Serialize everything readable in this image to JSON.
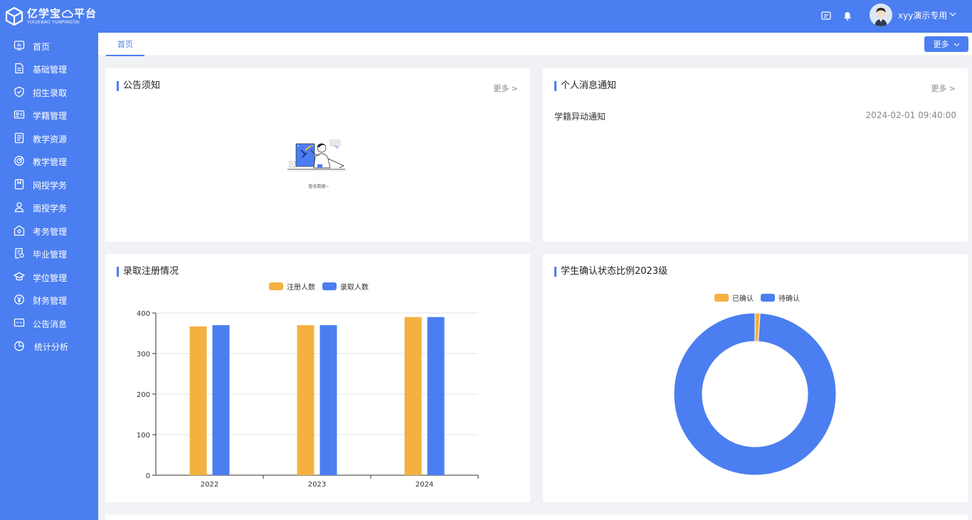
{
  "header": {
    "logo_main": "亿学宝",
    "logo_main2": "平台",
    "logo_sub": "YIXUEBAO YUNPINGTAI",
    "user_name": "xyy演示专用",
    "icons": [
      "screen-icon",
      "bell-icon",
      "chevron-down-icon"
    ]
  },
  "sidebar": {
    "items": [
      {
        "label": "首页",
        "icon": "dashboard-icon"
      },
      {
        "label": "基础管理",
        "icon": "document-icon"
      },
      {
        "label": "招生录取",
        "icon": "shield-check-icon"
      },
      {
        "label": "学籍管理",
        "icon": "id-card-icon"
      },
      {
        "label": "教学资源",
        "icon": "file-list-icon"
      },
      {
        "label": "教学管理",
        "icon": "target-icon"
      },
      {
        "label": "网授学务",
        "icon": "bookmark-icon"
      },
      {
        "label": "面授学务",
        "icon": "user-icon"
      },
      {
        "label": "考务管理",
        "icon": "exam-icon"
      },
      {
        "label": "毕业管理",
        "icon": "certificate-icon"
      },
      {
        "label": "学位管理",
        "icon": "graduation-cap-icon"
      },
      {
        "label": "财务管理",
        "icon": "yen-icon"
      },
      {
        "label": "公告消息",
        "icon": "message-icon"
      },
      {
        "label": "统计分析",
        "icon": "pie-chart-icon"
      }
    ]
  },
  "tabs": {
    "active": "首页",
    "more_label": "更多"
  },
  "notice_card": {
    "title": "公告须知",
    "more": "更多 >",
    "empty_text": "暂无数据~"
  },
  "message_card": {
    "title": "个人消息通知",
    "more": "更多 >",
    "items": [
      {
        "title": "学籍异动通知",
        "time": "2024-02-01 09:40:00"
      }
    ]
  },
  "colors": {
    "primary": "#4b7ef0",
    "orange": "#f4b142",
    "blue": "#4b7ef0"
  },
  "chart_data": [
    {
      "type": "bar",
      "title": "录取注册情况",
      "categories": [
        "2022",
        "2023",
        "2024"
      ],
      "series": [
        {
          "name": "注册人数",
          "values": [
            367,
            370,
            390
          ],
          "color": "#f4b142"
        },
        {
          "name": "录取人数",
          "values": [
            370,
            370,
            390
          ],
          "color": "#4b7ef0"
        }
      ],
      "ylim": [
        0,
        400
      ],
      "yticks": [
        "0",
        "100",
        "200",
        "300",
        "400"
      ],
      "grid": true,
      "legend": "top-center"
    },
    {
      "type": "pie",
      "title": "学生确认状态比例2023级",
      "labels": [
        "已确认",
        "待确认"
      ],
      "values": [
        1,
        99
      ],
      "colors": [
        "#f4b142",
        "#4b7ef0"
      ],
      "donut": true,
      "legend": "top-center"
    }
  ]
}
